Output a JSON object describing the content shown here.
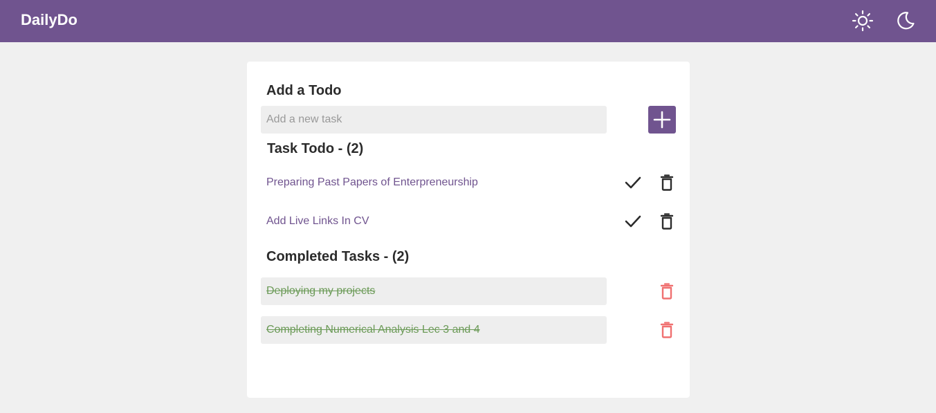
{
  "header": {
    "brand": "DailyDo",
    "light_theme_icon": "sun-icon",
    "dark_theme_icon": "moon-icon",
    "colors": {
      "primary": "#70548f",
      "on_primary": "#ffffff"
    }
  },
  "add_section": {
    "title": "Add a Todo",
    "input_value": "",
    "input_placeholder": "Add a new task",
    "add_button_icon": "plus-icon"
  },
  "todo_section": {
    "title": "Task Todo - (2)",
    "items": [
      {
        "text": "Preparing Past Papers of Enterpreneurship",
        "complete_icon": "check-icon",
        "delete_icon": "trash-icon"
      },
      {
        "text": "Add Live Links In CV",
        "complete_icon": "check-icon",
        "delete_icon": "trash-icon"
      }
    ]
  },
  "completed_section": {
    "title": "Completed Tasks - (2)",
    "items": [
      {
        "text": "Deploying my projects",
        "delete_icon": "trash-icon"
      },
      {
        "text": "Completing Numerical Analysis Lec 3 and 4",
        "delete_icon": "trash-icon"
      }
    ],
    "colors": {
      "text": "#6b9a57",
      "delete": "#f07070"
    }
  }
}
